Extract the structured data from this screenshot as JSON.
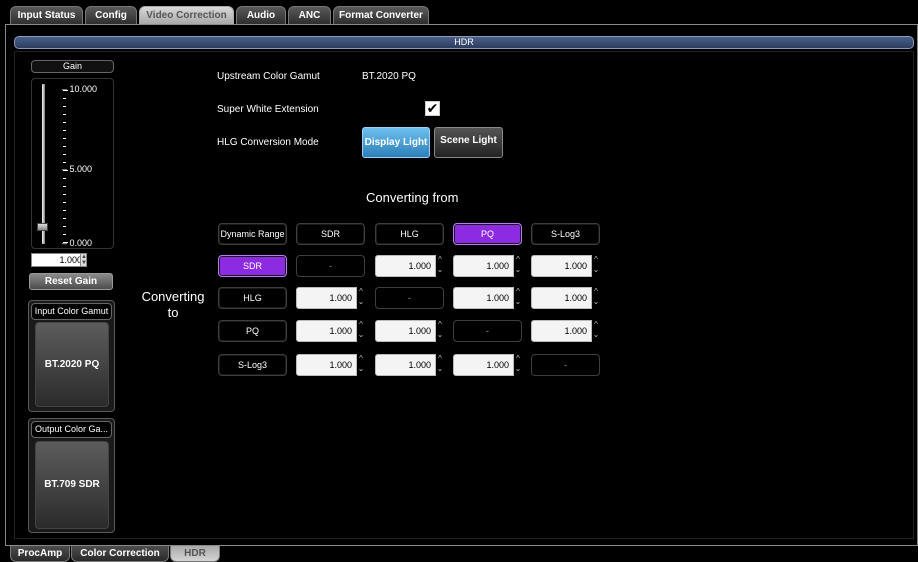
{
  "top_tabs": [
    {
      "label": "Input Status"
    },
    {
      "label": "Config"
    },
    {
      "label": "Video Correction",
      "active": true
    },
    {
      "label": "Audio"
    },
    {
      "label": "ANC"
    },
    {
      "label": "Format Converter"
    }
  ],
  "panel": {
    "title": "HDR"
  },
  "gain": {
    "label": "Gain",
    "tick_max": "10.000",
    "tick_mid": "5.000",
    "tick_min": "0.000",
    "value": "1.000",
    "reset_label": "Reset Gain"
  },
  "input_gamut": {
    "label": "Input Color Gamut",
    "value": "BT.2020 PQ"
  },
  "output_gamut": {
    "label": "Output Color Ga...",
    "value": "BT.709 SDR"
  },
  "settings": {
    "upstream_label": "Upstream Color Gamut",
    "upstream_value": "BT.2020 PQ",
    "super_white_label": "Super White Extension",
    "super_white_checked": true,
    "hlg_mode_label": "HLG Conversion Mode",
    "hlg_modes": [
      "Display Light",
      "Scene Light"
    ],
    "hlg_mode_selected": "Display Light"
  },
  "matrix": {
    "from_title": "Converting from",
    "to_title_line1": "Converting",
    "to_title_line2": "to",
    "corner_label": "Dynamic Range",
    "columns": [
      "SDR",
      "HLG",
      "PQ",
      "S-Log3"
    ],
    "active_column": "PQ",
    "rows": [
      {
        "label": "SDR",
        "active": true,
        "cells": [
          "-",
          "1.000",
          "1.000",
          "1.000"
        ]
      },
      {
        "label": "HLG",
        "active": false,
        "cells": [
          "1.000",
          "-",
          "1.000",
          "1.000"
        ]
      },
      {
        "label": "PQ",
        "active": false,
        "cells": [
          "1.000",
          "1.000",
          "-",
          "1.000"
        ]
      },
      {
        "label": "S-Log3",
        "active": false,
        "cells": [
          "1.000",
          "1.000",
          "1.000",
          "-"
        ]
      }
    ]
  },
  "bottom_tabs": [
    {
      "label": "ProcAmp"
    },
    {
      "label": "Color Correction"
    },
    {
      "label": "HDR",
      "active": true
    }
  ],
  "colors": {
    "accent_purple": "#8d2be2",
    "accent_blue": "#3b96d4",
    "header_blue": "#3a4d74"
  }
}
